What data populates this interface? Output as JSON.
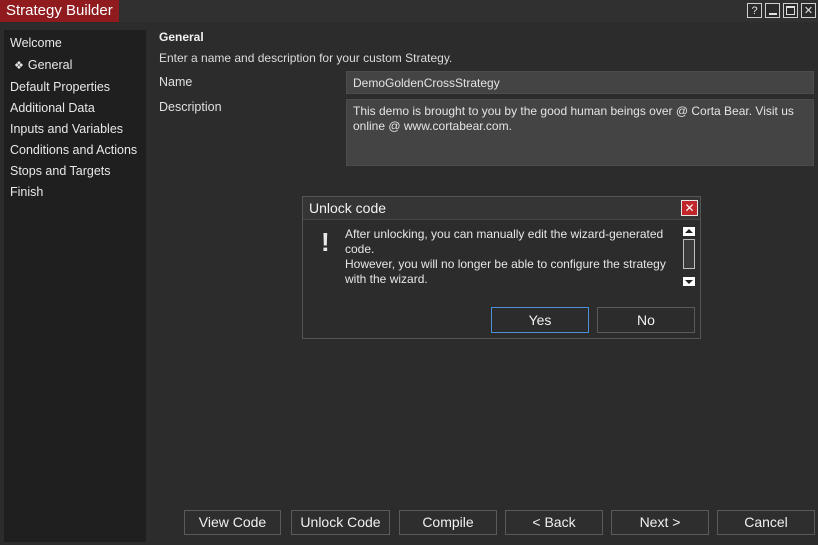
{
  "window": {
    "title": "Strategy Builder",
    "controls": [
      "?",
      "_",
      "□",
      "✕"
    ]
  },
  "nav": {
    "items": [
      {
        "label": "Welcome"
      },
      {
        "label": "General",
        "icon": "❖"
      },
      {
        "label": "Default Properties"
      },
      {
        "label": "Additional Data"
      },
      {
        "label": "Inputs and Variables"
      },
      {
        "label": "Conditions and Actions"
      },
      {
        "label": "Stops and Targets"
      },
      {
        "label": "Finish"
      }
    ]
  },
  "general": {
    "title": "General",
    "description": "Enter a name and description for your custom Strategy.",
    "name_label": "Name",
    "name_value": "DemoGoldenCrossStrategy",
    "description_label": "Description",
    "description_value_line1": "This demo is brought to you by the good human beings over @ Corta Bear. Visit us",
    "description_value_line2": "online @ www.cortabear.com."
  },
  "dialog": {
    "title": "Unlock code",
    "close": "✕",
    "icon": "!",
    "message_lines": [
      "After unlocking, you can manually edit the wizard-generated",
      "code.",
      "However, you will no longer be able to configure the strategy",
      "with the wizard."
    ],
    "yes_label": "Yes",
    "no_label": "No"
  },
  "footer": {
    "view_code": "View Code",
    "unlock_code": "Unlock Code",
    "compile": "Compile",
    "back": "< Back",
    "next": "Next >",
    "cancel": "Cancel"
  },
  "colors": {
    "accent_red": "#8f1b1f",
    "close_red": "#c0262a",
    "focus_border": "#4a8fd8"
  }
}
